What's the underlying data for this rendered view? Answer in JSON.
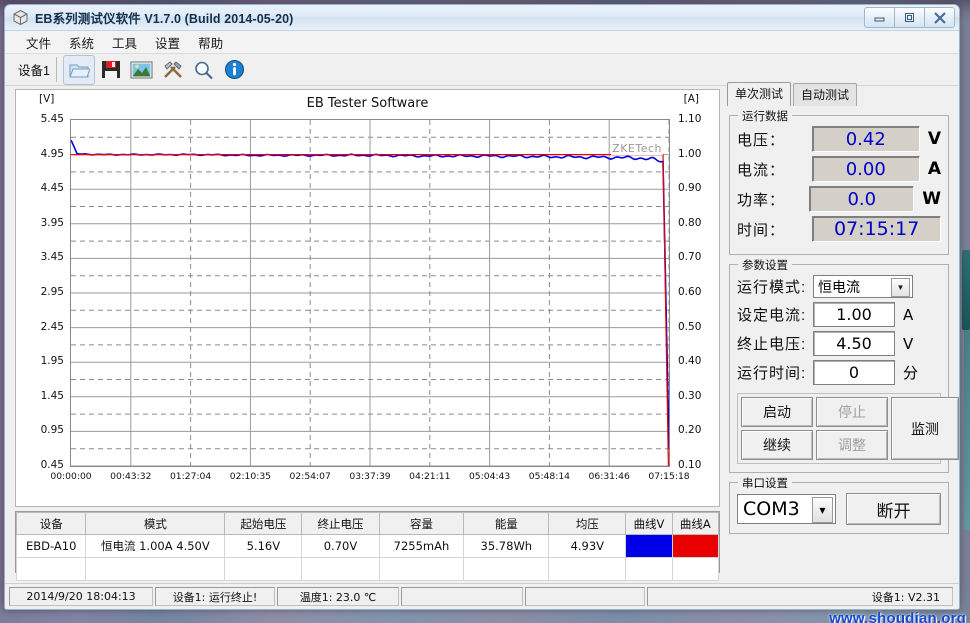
{
  "window": {
    "title": "EB系列测试仪软件 V1.7.0 (Build 2014-05-20)",
    "icon": "cube-icon",
    "buttons": {
      "minimize": "—",
      "maximize": "❐",
      "close": "✕"
    }
  },
  "menu": {
    "items": [
      "文件",
      "系统",
      "工具",
      "设置",
      "帮助"
    ]
  },
  "toolbar": {
    "device_tab": "设备1",
    "icons": [
      "open-folder-icon",
      "save-floppy-icon",
      "image-icon",
      "tools-icon",
      "zoom-icon",
      "info-icon"
    ]
  },
  "chart_data": {
    "type": "line",
    "title": "EB Tester Software",
    "watermark": "ZKETech",
    "xlabel": "",
    "y_left_unit": "[V]",
    "y_right_unit": "[A]",
    "y_left_ticks": [
      "5.45",
      "4.95",
      "4.45",
      "3.95",
      "3.45",
      "2.95",
      "2.45",
      "1.95",
      "1.45",
      "0.95",
      "0.45"
    ],
    "y_right_ticks": [
      "1.10",
      "1.00",
      "0.90",
      "0.80",
      "0.70",
      "0.60",
      "0.50",
      "0.40",
      "0.30",
      "0.20",
      "0.10"
    ],
    "ylim_left": [
      0.45,
      5.45
    ],
    "ylim_right": [
      0.1,
      1.1
    ],
    "x_ticks": [
      "00:00:00",
      "00:43:32",
      "01:27:04",
      "02:10:35",
      "02:54:07",
      "03:37:39",
      "04:21:11",
      "05:04:43",
      "05:48:14",
      "06:31:46",
      "07:15:18"
    ],
    "grid": true,
    "legend_position": "none",
    "series": [
      {
        "name": "曲线V",
        "color": "#0000e8",
        "unit": "V",
        "x": [
          0,
          0.01,
          0.05,
          0.1,
          0.2,
          0.3,
          0.4,
          0.5,
          0.6,
          0.7,
          0.8,
          0.9,
          0.95,
          0.975,
          0.99,
          1.0
        ],
        "values": [
          5.16,
          4.96,
          4.95,
          4.95,
          4.95,
          4.94,
          4.94,
          4.94,
          4.93,
          4.93,
          4.92,
          4.91,
          4.9,
          4.88,
          4.85,
          0.7
        ]
      },
      {
        "name": "曲线A",
        "color": "#e80000",
        "unit": "A",
        "x": [
          0,
          0.01,
          0.05,
          0.1,
          0.2,
          0.3,
          0.4,
          0.5,
          0.6,
          0.7,
          0.8,
          0.9,
          0.95,
          0.975,
          0.99,
          1.0
        ],
        "values": [
          1.0,
          1.0,
          1.0,
          1.0,
          1.0,
          1.0,
          1.0,
          1.0,
          1.0,
          1.0,
          1.0,
          1.0,
          1.0,
          1.0,
          1.0,
          0.0
        ]
      }
    ]
  },
  "results_table": {
    "headers": [
      "设备",
      "模式",
      "起始电压",
      "终止电压",
      "容量",
      "能量",
      "均压",
      "曲线V",
      "曲线A"
    ],
    "rows": [
      {
        "cells": [
          "EBD-A10",
          "恒电流 1.00A 4.50V",
          "5.16V",
          "0.70V",
          "7255mAh",
          "35.78Wh",
          "4.93V",
          "",
          ""
        ],
        "curve_v_color": "#0000e8",
        "curve_a_color": "#e80000"
      }
    ]
  },
  "right_panel": {
    "tabs": [
      {
        "label": "单次测试",
        "active": true
      },
      {
        "label": "自动测试",
        "active": false
      }
    ],
    "running_data": {
      "legend": "运行数据",
      "fields": [
        {
          "label": "电压：",
          "value": "0.42",
          "unit": "V"
        },
        {
          "label": "电流：",
          "value": "0.00",
          "unit": "A"
        },
        {
          "label": "功率：",
          "value": "0.0",
          "unit": "W"
        },
        {
          "label": "时间：",
          "value": "07:15:17",
          "unit": ""
        }
      ]
    },
    "parameters": {
      "legend": "参数设置",
      "mode": {
        "label": "运行模式:",
        "value": "恒电流",
        "unit": ""
      },
      "set_current": {
        "label": "设定电流:",
        "value": "1.00",
        "unit": "A"
      },
      "cutoff_voltage": {
        "label": "终止电压:",
        "value": "4.50",
        "unit": "V"
      },
      "run_time": {
        "label": "运行时间:",
        "value": "0",
        "unit": "分"
      },
      "buttons": [
        {
          "label": "启动",
          "disabled": false
        },
        {
          "label": "停止",
          "disabled": true
        },
        {
          "label": "继续",
          "disabled": false
        },
        {
          "label": "调整",
          "disabled": true
        },
        {
          "label": "监测",
          "disabled": false
        }
      ]
    },
    "serial": {
      "legend": "串口设置",
      "port": "COM3",
      "button": "断开"
    }
  },
  "statusbar": {
    "cells": [
      "2014/9/20 18:04:13",
      "设备1: 运行终止!",
      "温度1: 23.0 ℃",
      "",
      "",
      "设备1: V2.31"
    ],
    "watermark": "www.shoudian.org"
  }
}
